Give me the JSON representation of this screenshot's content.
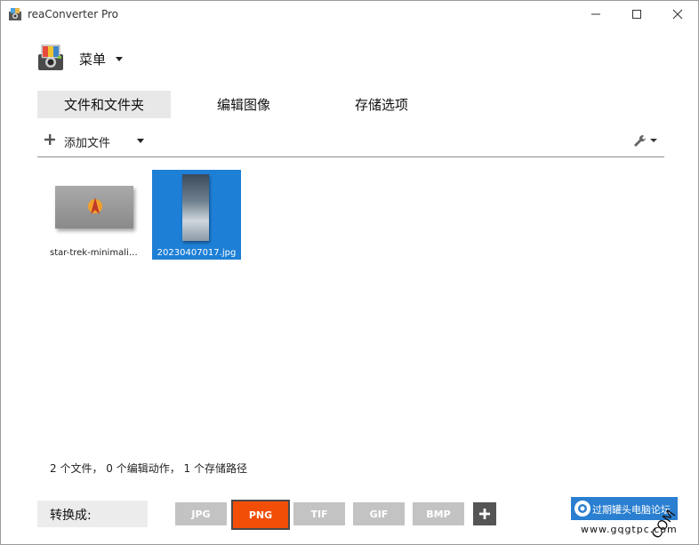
{
  "window": {
    "title": "reaConverter Pro",
    "minimize_icon": "minimize-icon",
    "maximize_icon": "maximize-icon",
    "close_icon": "close-icon"
  },
  "menu": {
    "label": "菜单"
  },
  "tabs": [
    {
      "label": "文件和文件夹",
      "active": true
    },
    {
      "label": "编辑图像",
      "active": false
    },
    {
      "label": "存储选项",
      "active": false
    }
  ],
  "toolbar": {
    "add_files_label": "添加文件",
    "settings_icon": "wrench-icon"
  },
  "files": [
    {
      "name": "star-trek-minimalis...",
      "selected": false
    },
    {
      "name": "20230407017.jpg",
      "selected": true
    }
  ],
  "status": {
    "text": "2 个文件， 0 个编辑动作， 1 个存储路径"
  },
  "convert": {
    "label": "转换成:",
    "formats": [
      {
        "label": "JPG",
        "active": false
      },
      {
        "label": "PNG",
        "active": true
      },
      {
        "label": "TIF",
        "active": false
      },
      {
        "label": "GIF",
        "active": false
      },
      {
        "label": "BMP",
        "active": false
      }
    ],
    "active_color": "#f24e08",
    "inactive_color": "#c3c3c3"
  },
  "watermark": {
    "banner_text": "过期罐头电脑论坛",
    "url": "www.gqgtpc.com",
    "side_text": "COM"
  },
  "colors": {
    "selection": "#1e7fd6",
    "active_tab_bg": "#e8e8e8"
  }
}
